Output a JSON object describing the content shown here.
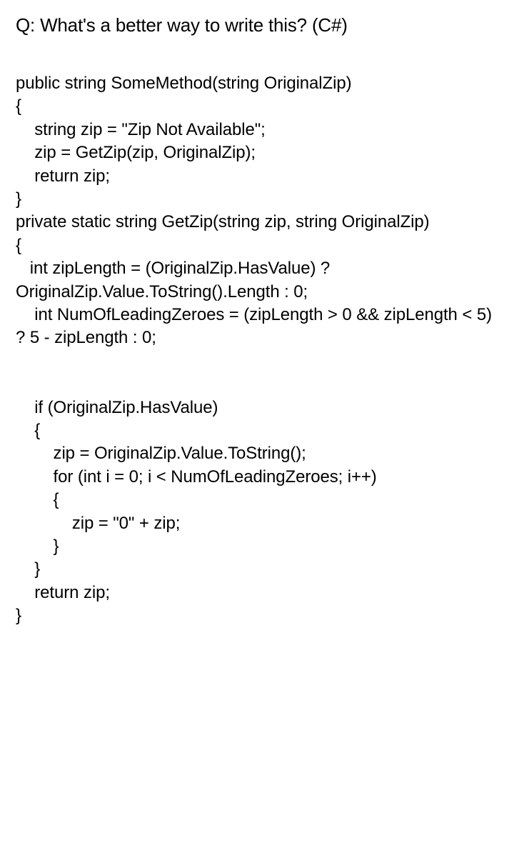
{
  "question": {
    "prefix": "Q: ",
    "title": "What's a better way to write this? (C#)"
  },
  "code": "public string SomeMethod(string OriginalZip)\n{\n    string zip = \"Zip Not Available\";\n    zip = GetZip(zip, OriginalZip);\n    return zip;\n}\nprivate static string GetZip(string zip, string OriginalZip)\n{\n   int zipLength = (OriginalZip.HasValue) ? OriginalZip.Value.ToString().Length : 0;\n    int NumOfLeadingZeroes = (zipLength > 0 && zipLength < 5) ? 5 - zipLength : 0;\n\n\n    if (OriginalZip.HasValue)\n    {\n        zip = OriginalZip.Value.ToString();\n        for (int i = 0; i < NumOfLeadingZeroes; i++)\n        {\n            zip = \"0\" + zip;\n        }\n    }\n    return zip;\n}"
}
